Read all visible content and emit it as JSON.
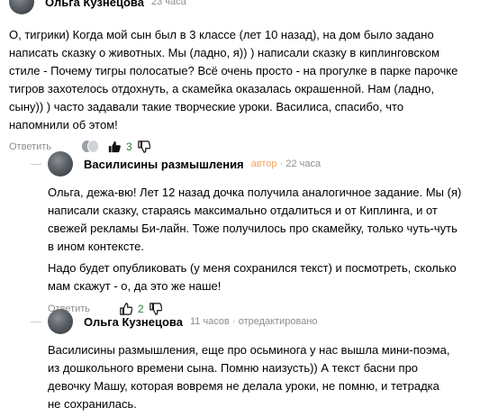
{
  "comments": [
    {
      "author": "Ольга Кузнецова",
      "time": "23 часа",
      "paragraphs": [
        "О, тигрики) Когда мой сын был в 3 классе (лет 10 назад), на дом было задано написать сказку о животных. Мы (ладно, я)) ) написали сказку в киплинговском стиле - Почему тигры полосатые? Всё очень просто - на прогулке в парке парочке тигров захотелось отдохнуть, а скамейка оказалась окрашенной. Нам (ладно, сыну)) ) часто задавали такие творческие уроки. Василиса, спасибо, что напомнили об этом!"
      ],
      "reply_label": "Ответить",
      "likes": "3"
    },
    {
      "author": "Василисины размышления",
      "badge": "автор",
      "separator": "·",
      "time": "22 часа",
      "paragraphs": [
        "Ольга, дежа-вю! Лет 12 назад дочка получила аналогичное задание. Мы (я) написали сказку, стараясь максимально отдалиться и от Киплинга, и от свежей рекламы Би-лайн. Тоже получилось про скамейку, только чуть-чуть в ином контексте.",
        "Надо будет опубликовать (у меня сохранился текст) и посмотреть, сколько мам скажут - о, да это же наше!"
      ],
      "reply_label": "Ответить",
      "likes": "2"
    },
    {
      "author": "Ольга Кузнецова",
      "time": "11 часов",
      "separator": "·",
      "status": "отредактировано",
      "paragraphs": [
        "Василисины размышления, еще про осьминога у нас вышла мини-поэма, из дошкольного времени сына. Помню наизусть)) А текст басни про девочку Машу, которая вовремя не делала уроки, не помню, и тетрадка не сохранилась."
      ]
    }
  ],
  "icons": {
    "like": "thumb-up-icon",
    "dislike": "thumb-down-icon"
  }
}
